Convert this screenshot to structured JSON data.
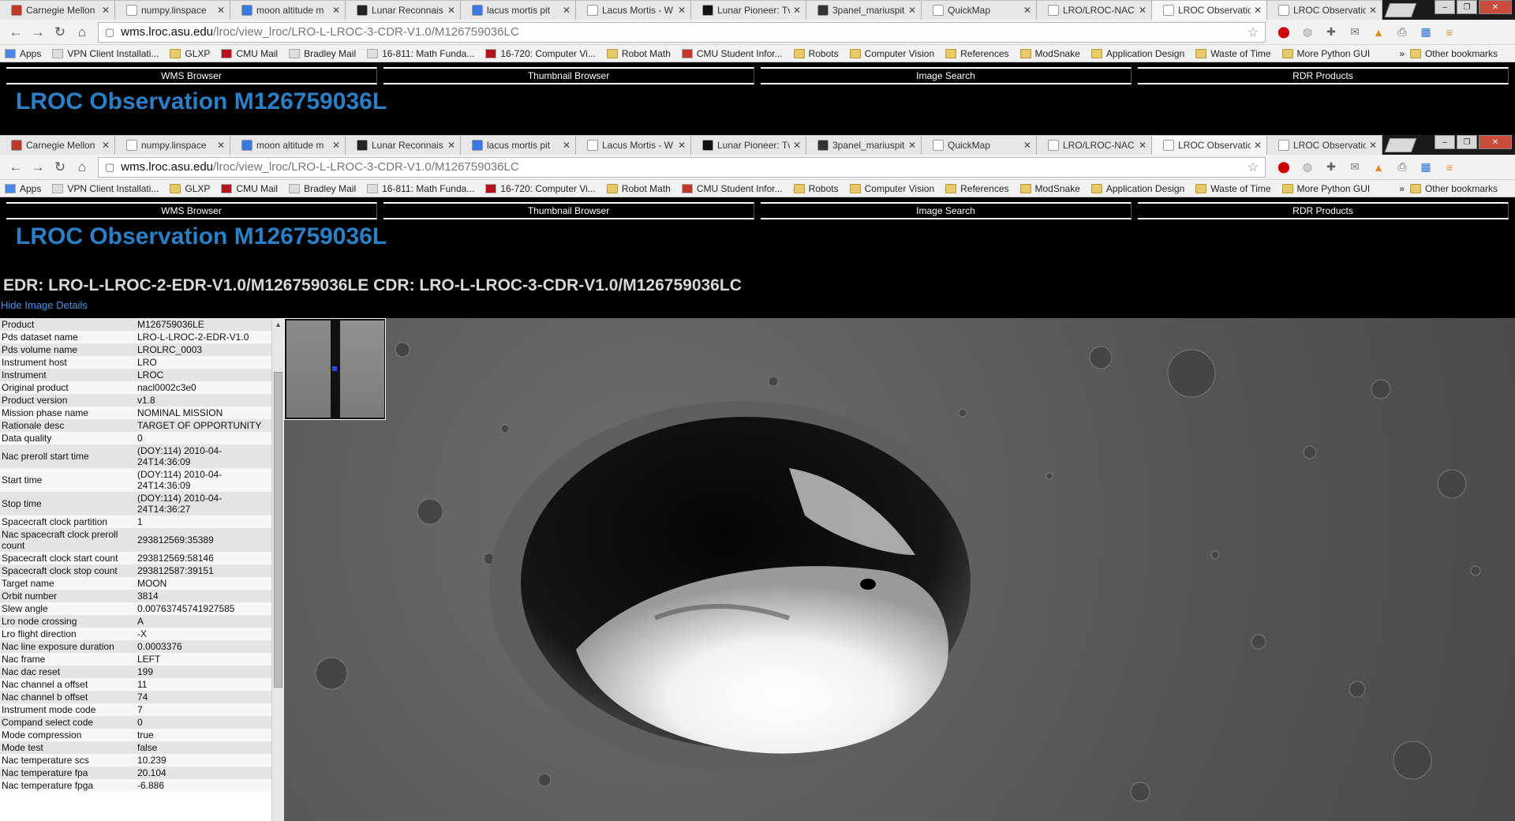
{
  "tabs": [
    {
      "title": "Carnegie Mellon",
      "icon": "mail-icon",
      "color": "#c0392b"
    },
    {
      "title": "numpy.linspace",
      "icon": "page-icon",
      "color": "#ffffff"
    },
    {
      "title": "moon altitude m",
      "icon": "google-icon",
      "color": "#3b78e7"
    },
    {
      "title": "Lunar Reconnais",
      "icon": "globe-icon",
      "color": "#222222"
    },
    {
      "title": "lacus mortis pit",
      "icon": "google-icon",
      "color": "#3b78e7"
    },
    {
      "title": "Lacus Mortis - W",
      "icon": "wikipedia-icon",
      "color": "#ffffff"
    },
    {
      "title": "Lunar Pioneer: Tv",
      "icon": "square-icon",
      "color": "#111111"
    },
    {
      "title": "3panel_mariuspit",
      "icon": "globe-icon",
      "color": "#333333"
    },
    {
      "title": "QuickMap",
      "icon": "blank-icon",
      "color": "#ffffff"
    },
    {
      "title": "LRO/LROC-NAC",
      "icon": "blank-icon",
      "color": "#ffffff"
    },
    {
      "title": "LROC Observatio",
      "icon": "page-icon",
      "color": "#ffffff",
      "active": true
    },
    {
      "title": "LROC Observatio",
      "icon": "page-icon",
      "color": "#ffffff"
    }
  ],
  "omnibox": {
    "host": "wms.lroc.asu.edu",
    "path": "/lroc/view_lroc/LRO-L-LROC-3-CDR-V1.0/M126759036LC"
  },
  "bookmarks": [
    {
      "label": "Apps",
      "icon": "apps-icon"
    },
    {
      "label": "VPN Client Installati...",
      "icon": "page-icon"
    },
    {
      "label": "GLXP",
      "icon": "folder-icon"
    },
    {
      "label": "CMU Mail",
      "icon": "cmu-icon"
    },
    {
      "label": "Bradley Mail",
      "icon": "bradley-icon"
    },
    {
      "label": "16-811: Math Funda...",
      "icon": "robot-icon"
    },
    {
      "label": "16-720: Computer Vi...",
      "icon": "cmu-icon"
    },
    {
      "label": "Robot Math",
      "icon": "folder-icon"
    },
    {
      "label": "CMU Student Infor...",
      "icon": "sio-icon"
    },
    {
      "label": "Robots",
      "icon": "folder-icon"
    },
    {
      "label": "Computer Vision",
      "icon": "folder-icon"
    },
    {
      "label": "References",
      "icon": "folder-icon"
    },
    {
      "label": "ModSnake",
      "icon": "folder-icon"
    },
    {
      "label": "Application Design",
      "icon": "folder-icon"
    },
    {
      "label": "Waste of Time",
      "icon": "folder-icon"
    },
    {
      "label": "More Python GUI",
      "icon": "folder-icon"
    }
  ],
  "bookmarks_more": "»",
  "bookmarks_other": "Other bookmarks",
  "sitenav": [
    "WMS Browser",
    "Thumbnail Browser",
    "Image Search",
    "RDR Products"
  ],
  "page_title": "LROC Observation M126759036L",
  "edr_heading": "EDR: LRO-L-LROC-2-EDR-V1.0/M126759036LE CDR: LRO-L-LROC-3-CDR-V1.0/M126759036LC",
  "hide_details": "Hide Image Details",
  "details": [
    [
      "Product",
      "M126759036LE"
    ],
    [
      "Pds dataset name",
      "LRO-L-LROC-2-EDR-V1.0"
    ],
    [
      "Pds volume name",
      "LROLRC_0003"
    ],
    [
      "Instrument host",
      "LRO"
    ],
    [
      "Instrument",
      "LROC"
    ],
    [
      "Original product",
      "nacl0002c3e0"
    ],
    [
      "Product version",
      "v1.8"
    ],
    [
      "Mission phase name",
      "NOMINAL MISSION"
    ],
    [
      "Rationale desc",
      "TARGET OF OPPORTUNITY"
    ],
    [
      "Data quality",
      "0"
    ],
    [
      "Nac preroll start time",
      "(DOY:114) 2010-04-24T14:36:09"
    ],
    [
      "Start time",
      "(DOY:114) 2010-04-24T14:36:09"
    ],
    [
      "Stop time",
      "(DOY:114) 2010-04-24T14:36:27"
    ],
    [
      "Spacecraft clock partition",
      "1"
    ],
    [
      "Nac spacecraft clock preroll count",
      "293812569:35389"
    ],
    [
      "Spacecraft clock start count",
      "293812569:58146"
    ],
    [
      "Spacecraft clock stop count",
      "293812587:39151"
    ],
    [
      "Target name",
      "MOON"
    ],
    [
      "Orbit number",
      "3814"
    ],
    [
      "Slew angle",
      "0.00763745741927585"
    ],
    [
      "Lro node crossing",
      "A"
    ],
    [
      "Lro flight direction",
      "-X"
    ],
    [
      "Nac line exposure duration",
      "0.0003376"
    ],
    [
      "Nac frame",
      "LEFT"
    ],
    [
      "Nac dac reset",
      "199"
    ],
    [
      "Nac channel a offset",
      "11"
    ],
    [
      "Nac channel b offset",
      "74"
    ],
    [
      "Instrument mode code",
      "7"
    ],
    [
      "Compand select code",
      "0"
    ],
    [
      "Mode compression",
      "true"
    ],
    [
      "Mode test",
      "false"
    ],
    [
      "Nac temperature scs",
      "10.239"
    ],
    [
      "Nac temperature fpa",
      "20.104"
    ],
    [
      "Nac temperature fpga",
      "-6.886"
    ]
  ]
}
